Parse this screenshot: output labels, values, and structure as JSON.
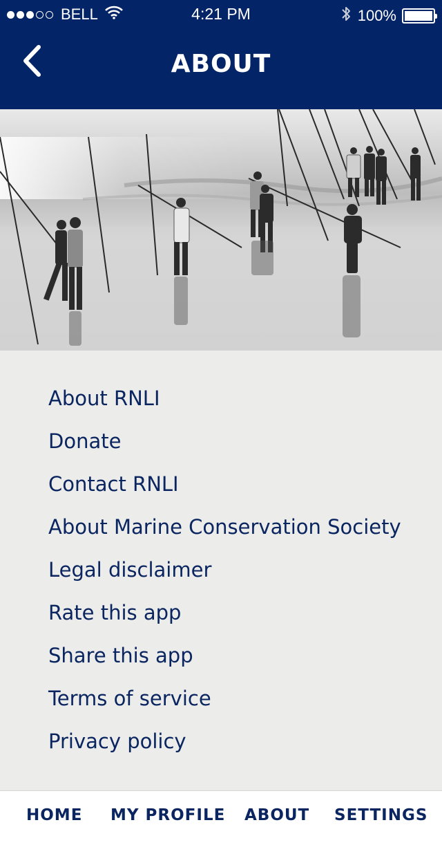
{
  "status_bar": {
    "carrier": "BELL",
    "signal_bars": 3,
    "signal_total": 5,
    "time": "4:21 PM",
    "battery_percent": "100%",
    "battery_level": 1.0,
    "icons": [
      "wifi-icon",
      "bluetooth-icon",
      "battery-icon"
    ]
  },
  "header": {
    "title": "ABOUT",
    "back_icon": "chevron-left-icon"
  },
  "hero_image": {
    "description_icon": "photo"
  },
  "menu": {
    "items": [
      {
        "label": "About RNLI"
      },
      {
        "label": "Donate"
      },
      {
        "label": "Contact RNLI"
      },
      {
        "label": "About Marine Conservation Society"
      },
      {
        "label": "Legal disclaimer"
      },
      {
        "label": "Rate this app"
      },
      {
        "label": "Share this app"
      },
      {
        "label": "Terms of service"
      },
      {
        "label": "Privacy policy"
      }
    ]
  },
  "tabbar": {
    "tabs": [
      {
        "label": "HOME"
      },
      {
        "label": "MY PROFILE"
      },
      {
        "label": "ABOUT"
      },
      {
        "label": "SETTINGS"
      }
    ]
  },
  "colors": {
    "brand_navy": "#032466",
    "text_navy": "#0a2560",
    "content_bg": "#ececea",
    "tabbar_bg": "#ffffff"
  }
}
